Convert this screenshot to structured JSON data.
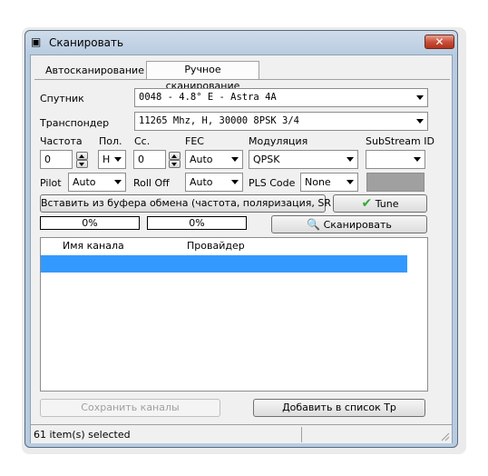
{
  "window": {
    "title": "Сканировать",
    "icon": "app-icon",
    "close_label": "✕"
  },
  "tabs": [
    {
      "label": "Автосканирование",
      "active": false
    },
    {
      "label": "Ручное сканирование",
      "active": true
    }
  ],
  "satellite": {
    "label": "Спутник",
    "value": "0048 -  4.8° E - Astra 4A"
  },
  "transponder": {
    "label": "Транспондер",
    "value": "11265 Mhz, H, 30000   8PSK 3/4"
  },
  "params": {
    "frequency": {
      "label": "Частота",
      "value": "0"
    },
    "polarization": {
      "label": "Пол.",
      "value": "H"
    },
    "symbol_rate": {
      "label": "Сс.",
      "value": "0"
    },
    "fec": {
      "label": "FEC",
      "value": "Auto"
    },
    "modulation": {
      "label": "Модуляция",
      "value": "QPSK"
    },
    "substream": {
      "label": "SubStream ID",
      "value": ""
    }
  },
  "params2": {
    "pilot": {
      "label": "Pilot",
      "value": "Auto"
    },
    "rolloff": {
      "label": "Roll Off",
      "value": "Auto"
    },
    "pls_code": {
      "label": "PLS Code",
      "value": "None"
    }
  },
  "buttons": {
    "paste": "Вставить из буфера обмена (частота, поляризация, SR ...)",
    "tune": "Tune",
    "scan": "Сканировать",
    "save_channels": "Сохранить каналы",
    "add_to_tp": "Добавить в список Тр"
  },
  "progress": [
    {
      "text": "0%",
      "fraction": 0
    },
    {
      "text": "0%",
      "fraction": 0
    }
  ],
  "channels": {
    "columns": [
      "Имя канала",
      "Провайдер"
    ],
    "rows": [
      {
        "name": "",
        "provider": "",
        "selected": true
      }
    ]
  },
  "status": {
    "text": "61 item(s) selected"
  },
  "colors": {
    "selection": "#3399ff",
    "tune_check": "#2fa82f"
  }
}
